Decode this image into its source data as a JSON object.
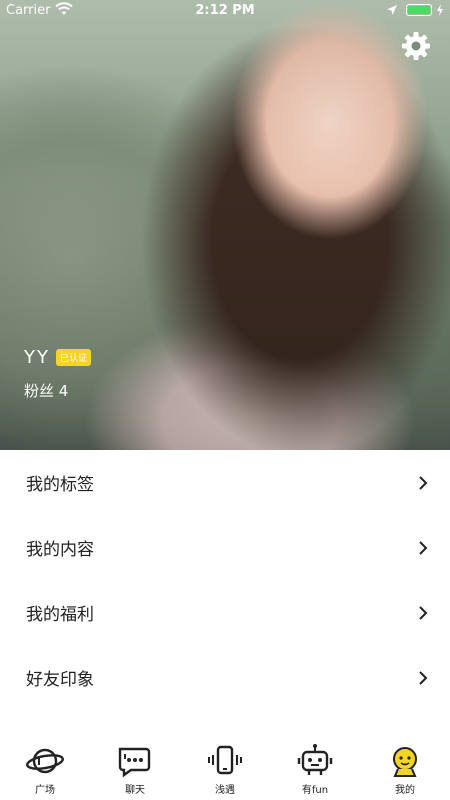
{
  "status_bar": {
    "carrier": "Carrier",
    "time": "2:12 PM"
  },
  "profile": {
    "name": "YY",
    "verified_badge": "已认证",
    "fans_label": "粉丝 4"
  },
  "menu": [
    {
      "label": "我的标签"
    },
    {
      "label": "我的内容"
    },
    {
      "label": "我的福利"
    },
    {
      "label": "好友印象"
    }
  ],
  "tabs": [
    {
      "label": "广场",
      "icon": "planet-icon"
    },
    {
      "label": "聊天",
      "icon": "chat-icon"
    },
    {
      "label": "浅遇",
      "icon": "phone-vibrate-icon"
    },
    {
      "label": "有fun",
      "icon": "robot-icon"
    },
    {
      "label": "我的",
      "icon": "profile-face-icon",
      "active": true
    }
  ],
  "colors": {
    "accent": "#f5d327",
    "battery": "#4cd964"
  }
}
